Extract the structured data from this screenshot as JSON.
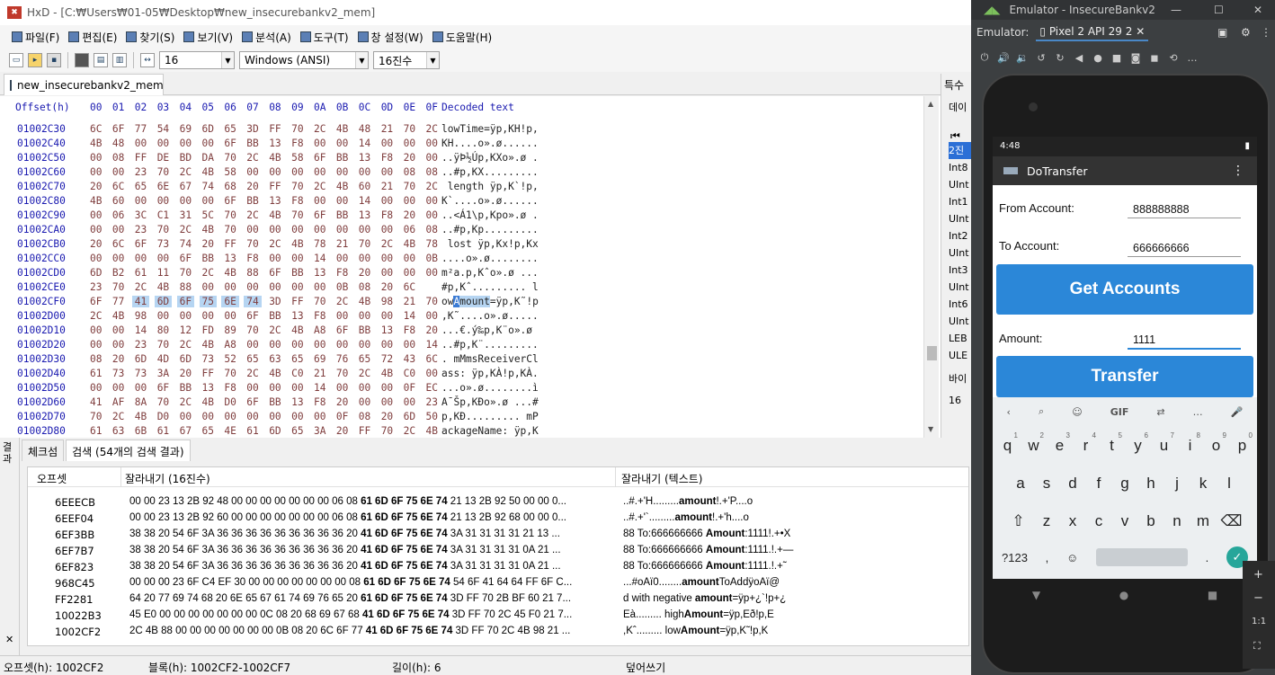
{
  "hxd": {
    "title": "HxD - [C:₩Users₩01-05₩Desktop₩new_insecurebankv2_mem]",
    "menu": [
      "파일(F)",
      "편집(E)",
      "찾기(S)",
      "보기(V)",
      "분석(A)",
      "도구(T)",
      "창 설정(W)",
      "도움말(H)"
    ],
    "toolbar": {
      "bytes_per_row": "16",
      "charset": "Windows (ANSI)",
      "base": "16진수"
    },
    "doc_tab": "new_insecurebankv2_mem",
    "side_header": "특수",
    "side_items": [
      "데이",
      "2진",
      "Int8",
      "UInt",
      "Int1",
      "UInt",
      "Int2",
      "UInt",
      "Int3",
      "UInt",
      "Int6",
      "UInt",
      "LEB",
      "ULE"
    ],
    "side_bottom": [
      "바이",
      "16"
    ],
    "header": {
      "offset": "Offset(h)",
      "cols": [
        "00",
        "01",
        "02",
        "03",
        "04",
        "05",
        "06",
        "07",
        "08",
        "09",
        "0A",
        "0B",
        "0C",
        "0D",
        "0E",
        "0F"
      ],
      "decoded": "Decoded text"
    },
    "rows": [
      {
        "off": "01002C30",
        "b": [
          "6C",
          "6F",
          "77",
          "54",
          "69",
          "6D",
          "65",
          "3D",
          "FF",
          "70",
          "2C",
          "4B",
          "48",
          "21",
          "70",
          "2C"
        ],
        "t": "lowTime=ÿp,KH!p,"
      },
      {
        "off": "01002C40",
        "b": [
          "4B",
          "48",
          "00",
          "00",
          "00",
          "00",
          "6F",
          "BB",
          "13",
          "F8",
          "00",
          "00",
          "14",
          "00",
          "00",
          "00"
        ],
        "t": "KH....o».ø......"
      },
      {
        "off": "01002C50",
        "b": [
          "00",
          "08",
          "FF",
          "DE",
          "BD",
          "DA",
          "70",
          "2C",
          "4B",
          "58",
          "6F",
          "BB",
          "13",
          "F8",
          "20",
          "00"
        ],
        "t": "..ÿÞ½Úp,KXo».ø ."
      },
      {
        "off": "01002C60",
        "b": [
          "00",
          "00",
          "23",
          "70",
          "2C",
          "4B",
          "58",
          "00",
          "00",
          "00",
          "00",
          "00",
          "00",
          "00",
          "08",
          "08"
        ],
        "t": "..#p,KX........."
      },
      {
        "off": "01002C70",
        "b": [
          "20",
          "6C",
          "65",
          "6E",
          "67",
          "74",
          "68",
          "20",
          "FF",
          "70",
          "2C",
          "4B",
          "60",
          "21",
          "70",
          "2C"
        ],
        "t": " length ÿp,K`!p,"
      },
      {
        "off": "01002C80",
        "b": [
          "4B",
          "60",
          "00",
          "00",
          "00",
          "00",
          "6F",
          "BB",
          "13",
          "F8",
          "00",
          "00",
          "14",
          "00",
          "00",
          "00"
        ],
        "t": "K`....o».ø......"
      },
      {
        "off": "01002C90",
        "b": [
          "00",
          "06",
          "3C",
          "C1",
          "31",
          "5C",
          "70",
          "2C",
          "4B",
          "70",
          "6F",
          "BB",
          "13",
          "F8",
          "20",
          "00"
        ],
        "t": "..<Á1\\p,Kpo».ø ."
      },
      {
        "off": "01002CA0",
        "b": [
          "00",
          "00",
          "23",
          "70",
          "2C",
          "4B",
          "70",
          "00",
          "00",
          "00",
          "00",
          "00",
          "00",
          "00",
          "06",
          "08"
        ],
        "t": "..#p,Kp........."
      },
      {
        "off": "01002CB0",
        "b": [
          "20",
          "6C",
          "6F",
          "73",
          "74",
          "20",
          "FF",
          "70",
          "2C",
          "4B",
          "78",
          "21",
          "70",
          "2C",
          "4B",
          "78"
        ],
        "t": " lost ÿp,Kx!p,Kx"
      },
      {
        "off": "01002CC0",
        "b": [
          "00",
          "00",
          "00",
          "00",
          "6F",
          "BB",
          "13",
          "F8",
          "00",
          "00",
          "14",
          "00",
          "00",
          "00",
          "00",
          "0B"
        ],
        "t": "....o».ø........"
      },
      {
        "off": "01002CD0",
        "b": [
          "6D",
          "B2",
          "61",
          "11",
          "70",
          "2C",
          "4B",
          "88",
          "6F",
          "BB",
          "13",
          "F8",
          "20",
          "00",
          "00",
          "00"
        ],
        "t": "m²a.p,Kˆo».ø ..."
      },
      {
        "off": "01002CE0",
        "b": [
          "23",
          "70",
          "2C",
          "4B",
          "88",
          "00",
          "00",
          "00",
          "00",
          "00",
          "00",
          "0B",
          "08",
          "20",
          "6C"
        ],
        "t": "#p,Kˆ......... l"
      },
      {
        "off": "01002CF0",
        "b": [
          "6F",
          "77",
          "41",
          "6D",
          "6F",
          "75",
          "6E",
          "74",
          "3D",
          "FF",
          "70",
          "2C",
          "4B",
          "98",
          "21",
          "70"
        ],
        "t": "owAmount=ÿp,K˜!p",
        "hl": true
      },
      {
        "off": "01002D00",
        "b": [
          "2C",
          "4B",
          "98",
          "00",
          "00",
          "00",
          "00",
          "6F",
          "BB",
          "13",
          "F8",
          "00",
          "00",
          "00",
          "14",
          "00"
        ],
        "t": ",K˜....o».ø....."
      },
      {
        "off": "01002D10",
        "b": [
          "00",
          "00",
          "14",
          "80",
          "12",
          "FD",
          "89",
          "70",
          "2C",
          "4B",
          "A8",
          "6F",
          "BB",
          "13",
          "F8",
          "20"
        ],
        "t": "...€.ý‰p,K¨o».ø "
      },
      {
        "off": "01002D20",
        "b": [
          "00",
          "00",
          "23",
          "70",
          "2C",
          "4B",
          "A8",
          "00",
          "00",
          "00",
          "00",
          "00",
          "00",
          "00",
          "00",
          "14"
        ],
        "t": "..#p,K¨........."
      },
      {
        "off": "01002D30",
        "b": [
          "08",
          "20",
          "6D",
          "4D",
          "6D",
          "73",
          "52",
          "65",
          "63",
          "65",
          "69",
          "76",
          "65",
          "72",
          "43",
          "6C"
        ],
        "t": ". mMmsReceiverCl"
      },
      {
        "off": "01002D40",
        "b": [
          "61",
          "73",
          "73",
          "3A",
          "20",
          "FF",
          "70",
          "2C",
          "4B",
          "C0",
          "21",
          "70",
          "2C",
          "4B",
          "C0",
          "00"
        ],
        "t": "ass: ÿp,KÀ!p,KÀ."
      },
      {
        "off": "01002D50",
        "b": [
          "00",
          "00",
          "00",
          "6F",
          "BB",
          "13",
          "F8",
          "00",
          "00",
          "00",
          "14",
          "00",
          "00",
          "00",
          "0F",
          "EC"
        ],
        "t": "...o».ø........ì"
      },
      {
        "off": "01002D60",
        "b": [
          "41",
          "AF",
          "8A",
          "70",
          "2C",
          "4B",
          "D0",
          "6F",
          "BB",
          "13",
          "F8",
          "20",
          "00",
          "00",
          "00",
          "23"
        ],
        "t": "A¯Šp,KÐo».ø ...#"
      },
      {
        "off": "01002D70",
        "b": [
          "70",
          "2C",
          "4B",
          "D0",
          "00",
          "00",
          "00",
          "00",
          "00",
          "00",
          "00",
          "0F",
          "08",
          "20",
          "6D",
          "50"
        ],
        "t": "p,KÐ......... mP"
      },
      {
        "off": "01002D80",
        "b": [
          "61",
          "63",
          "6B",
          "61",
          "67",
          "65",
          "4E",
          "61",
          "6D",
          "65",
          "3A",
          "20",
          "FF",
          "70",
          "2C",
          "4B"
        ],
        "t": "ackageName: ÿp,K"
      }
    ],
    "results_side": "결과",
    "results_tabs": [
      "체크섬",
      "검색 (54개의 검색 결과)"
    ],
    "results_head": [
      "오프셋",
      "잘라내기 (16진수)",
      "잘라내기 (텍스트)"
    ],
    "results": [
      {
        "off": "6EEECB",
        "hex": "00 00 23 13 2B 92 48 00 00 00 00 00 00 00 06 08 61 6D 6F 75 6E 74 21 13 2B 92 50 00 00 0...",
        "txt": "..#.+'H.........amount!.+'P....o"
      },
      {
        "off": "6EEF04",
        "hex": "00 00 23 13 2B 92 60 00 00 00 00 00 00 00 06 08 61 6D 6F 75 6E 74 21 13 2B 92 68 00 00 0...",
        "txt": "..#.+'`.........amount!.+'h....o"
      },
      {
        "off": "6EF3BB",
        "hex": "38 38 20 54 6F 3A 36 36 36 36 36 36 36 36 36 20 41 6D 6F 75 6E 74 3A 31 31 31 31 21 13 ...",
        "txt": "88 To:666666666 Amount:1111!.+•X"
      },
      {
        "off": "6EF7B7",
        "hex": "38 38 20 54 6F 3A 36 36 36 36 36 36 36 36 36 20 41 6D 6F 75 6E 74 3A 31 31 31 31 0A 21 ...",
        "txt": "88 To:666666666 Amount:1111.!.+—"
      },
      {
        "off": "6EF823",
        "hex": "38 38 20 54 6F 3A 36 36 36 36 36 36 36 36 36 20 41 6D 6F 75 6E 74 3A 31 31 31 31 0A 21 ...",
        "txt": "88 To:666666666 Amount:1111.!.+˜"
      },
      {
        "off": "968C45",
        "hex": "00 00 00 23 6F C4 EF 30 00 00 00 00 00 00 00 08 61 6D 6F 75 6E 74 54 6F 41 64 64 FF 6F C...",
        "txt": "...#oÄï0........amountToAddÿoÄï@"
      },
      {
        "off": "FF2281",
        "hex": "64 20 77 69 74 68 20 6E 65 67 61 74 69 76 65 20 61 6D 6F 75 6E 74 3D FF 70 2B BF 60 21 7...",
        "txt": "d with negative amount=ÿp+¿`!p+¿"
      },
      {
        "off": "10022B3",
        "hex": "45 E0 00 00 00 00 00 00 00 0C 08 20 68 69 67 68 41 6D 6F 75 6E 74 3D FF 70 2C 45 F0 21 7...",
        "txt": "Eà......... highAmount=ÿp,Eð!p,E"
      },
      {
        "off": "1002CF2",
        "hex": "2C 4B 88 00 00 00 00 00 00 00 0B 08 20 6C 6F 77 41 6D 6F 75 6E 74 3D FF 70 2C 4B 98 21 ...",
        "txt": ",Kˆ......... lowAmount=ÿp,K˜!p,K"
      }
    ],
    "status": {
      "offset": "오프셋(h): 1002CF2",
      "block": "블록(h): 1002CF2-1002CF7",
      "length": "길이(h): 6",
      "mode": "덮어쓰기"
    }
  },
  "emulator": {
    "title": "Emulator - InsecureBankv2",
    "device_label": "Emulator:",
    "device": "Pixel 2 API 29 2",
    "time": "4:48",
    "app_title": "DoTransfer",
    "from_label": "From Account:",
    "from_value": "888888888",
    "to_label": "To Account:",
    "to_value": "666666666",
    "get_accounts": "Get Accounts",
    "amount_label": "Amount:",
    "amount_value": "1111",
    "transfer": "Transfer",
    "kb_row1": [
      "q",
      "w",
      "e",
      "r",
      "t",
      "y",
      "u",
      "i",
      "o",
      "p"
    ],
    "kb_row1_num": [
      "1",
      "2",
      "3",
      "4",
      "5",
      "6",
      "7",
      "8",
      "9",
      "0"
    ],
    "kb_row2": [
      "a",
      "s",
      "d",
      "f",
      "g",
      "h",
      "j",
      "k",
      "l"
    ],
    "kb_row3": [
      "z",
      "x",
      "c",
      "v",
      "b",
      "n",
      "m"
    ],
    "kb_sym": "?123",
    "kb_comma": ",",
    "kb_period": ".",
    "kb_gif": "GIF",
    "zoom": "1:1"
  }
}
